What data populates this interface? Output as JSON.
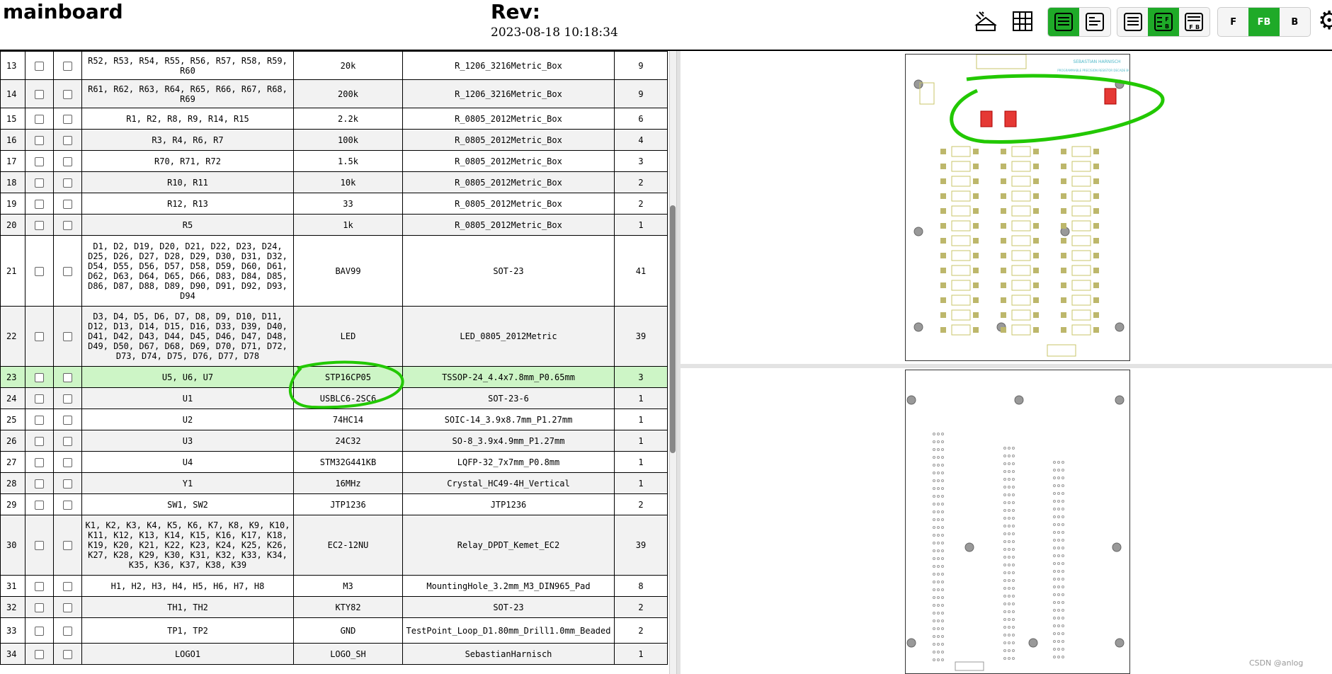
{
  "header": {
    "title": "mainboard",
    "rev_label": "Rev:",
    "rev_date": "2023-08-18 10:18:34"
  },
  "toolbar": {
    "icons": [
      "dark-mode-toggle-icon",
      "grid-icon",
      "layout-bom-left-icon",
      "layout-bom-top-icon",
      "bom-only-icon",
      "bom-left-fb-icon",
      "bom-top-fb-icon",
      "gear-icon"
    ],
    "layers": {
      "front": "F",
      "front_back": "FB",
      "back": "B",
      "selected": "FB"
    },
    "accent_color": "#1faa28"
  },
  "bom": {
    "rows": [
      {
        "idx": "13",
        "refs": "R52, R53, R54, R55, R56, R57, R58, R59, R60",
        "value": "20k",
        "footprint": "R_1206_3216Metric_Box",
        "qty": "9"
      },
      {
        "idx": "14",
        "refs": "R61, R62, R63, R64, R65, R66, R67, R68, R69",
        "value": "200k",
        "footprint": "R_1206_3216Metric_Box",
        "qty": "9"
      },
      {
        "idx": "15",
        "refs": "R1, R2, R8, R9, R14, R15",
        "value": "2.2k",
        "footprint": "R_0805_2012Metric_Box",
        "qty": "6"
      },
      {
        "idx": "16",
        "refs": "R3, R4, R6, R7",
        "value": "100k",
        "footprint": "R_0805_2012Metric_Box",
        "qty": "4"
      },
      {
        "idx": "17",
        "refs": "R70, R71, R72",
        "value": "1.5k",
        "footprint": "R_0805_2012Metric_Box",
        "qty": "3"
      },
      {
        "idx": "18",
        "refs": "R10, R11",
        "value": "10k",
        "footprint": "R_0805_2012Metric_Box",
        "qty": "2"
      },
      {
        "idx": "19",
        "refs": "R12, R13",
        "value": "33",
        "footprint": "R_0805_2012Metric_Box",
        "qty": "2"
      },
      {
        "idx": "20",
        "refs": "R5",
        "value": "1k",
        "footprint": "R_0805_2012Metric_Box",
        "qty": "1"
      },
      {
        "idx": "21",
        "refs": "D1, D2, D19, D20, D21, D22, D23, D24, D25, D26, D27, D28, D29, D30, D31, D32, D54, D55, D56, D57, D58, D59, D60, D61, D62, D63, D64, D65, D66, D83, D84, D85, D86, D87, D88, D89, D90, D91, D92, D93, D94",
        "value": "BAV99",
        "footprint": "SOT-23",
        "qty": "41"
      },
      {
        "idx": "22",
        "refs": "D3, D4, D5, D6, D7, D8, D9, D10, D11, D12, D13, D14, D15, D16, D33, D39, D40, D41, D42, D43, D44, D45, D46, D47, D48, D49, D50, D67, D68, D69, D70, D71, D72, D73, D74, D75, D76, D77, D78",
        "value": "LED",
        "footprint": "LED_0805_2012Metric",
        "qty": "39"
      },
      {
        "idx": "23",
        "refs": "U5, U6, U7",
        "value": "STP16CP05",
        "footprint": "TSSOP-24_4.4x7.8mm_P0.65mm",
        "qty": "3",
        "highlight": true
      },
      {
        "idx": "24",
        "refs": "U1",
        "value": "USBLC6-2SC6",
        "footprint": "SOT-23-6",
        "qty": "1"
      },
      {
        "idx": "25",
        "refs": "U2",
        "value": "74HC14",
        "footprint": "SOIC-14_3.9x8.7mm_P1.27mm",
        "qty": "1"
      },
      {
        "idx": "26",
        "refs": "U3",
        "value": "24C32",
        "footprint": "SO-8_3.9x4.9mm_P1.27mm",
        "qty": "1"
      },
      {
        "idx": "27",
        "refs": "U4",
        "value": "STM32G441KB",
        "footprint": "LQFP-32_7x7mm_P0.8mm",
        "qty": "1"
      },
      {
        "idx": "28",
        "refs": "Y1",
        "value": "16MHz",
        "footprint": "Crystal_HC49-4H_Vertical",
        "qty": "1"
      },
      {
        "idx": "29",
        "refs": "SW1, SW2",
        "value": "JTP1236",
        "footprint": "JTP1236",
        "qty": "2"
      },
      {
        "idx": "30",
        "refs": "K1, K2, K3, K4, K5, K6, K7, K8, K9, K10, K11, K12, K13, K14, K15, K16, K17, K18, K19, K20, K21, K22, K23, K24, K25, K26, K27, K28, K29, K30, K31, K32, K33, K34, K35, K36, K37, K38, K39",
        "value": "EC2-12NU",
        "footprint": "Relay_DPDT_Kemet_EC2",
        "qty": "39"
      },
      {
        "idx": "31",
        "refs": "H1, H2, H3, H4, H5, H6, H7, H8",
        "value": "M3",
        "footprint": "MountingHole_3.2mm_M3_DIN965_Pad",
        "qty": "8"
      },
      {
        "idx": "32",
        "refs": "TH1, TH2",
        "value": "KTY82",
        "footprint": "SOT-23",
        "qty": "2"
      },
      {
        "idx": "33",
        "refs": "TP1, TP2",
        "value": "GND",
        "footprint": "TestPoint_Loop_D1.80mm_Drill1.0mm_Beaded",
        "qty": "2"
      },
      {
        "idx": "34",
        "refs": "LOGO1",
        "value": "LOGO_SH",
        "footprint": "SebastianHarnisch",
        "qty": "1"
      }
    ]
  },
  "board": {
    "silk_title": "SEBASTIAN HARNISCH",
    "silk_subtitle": "PROGRAMMABLE PRECISION RESISTOR DECADE BOARD",
    "highlight_color": "#e53935"
  },
  "watermark": "CSDN @anlog"
}
